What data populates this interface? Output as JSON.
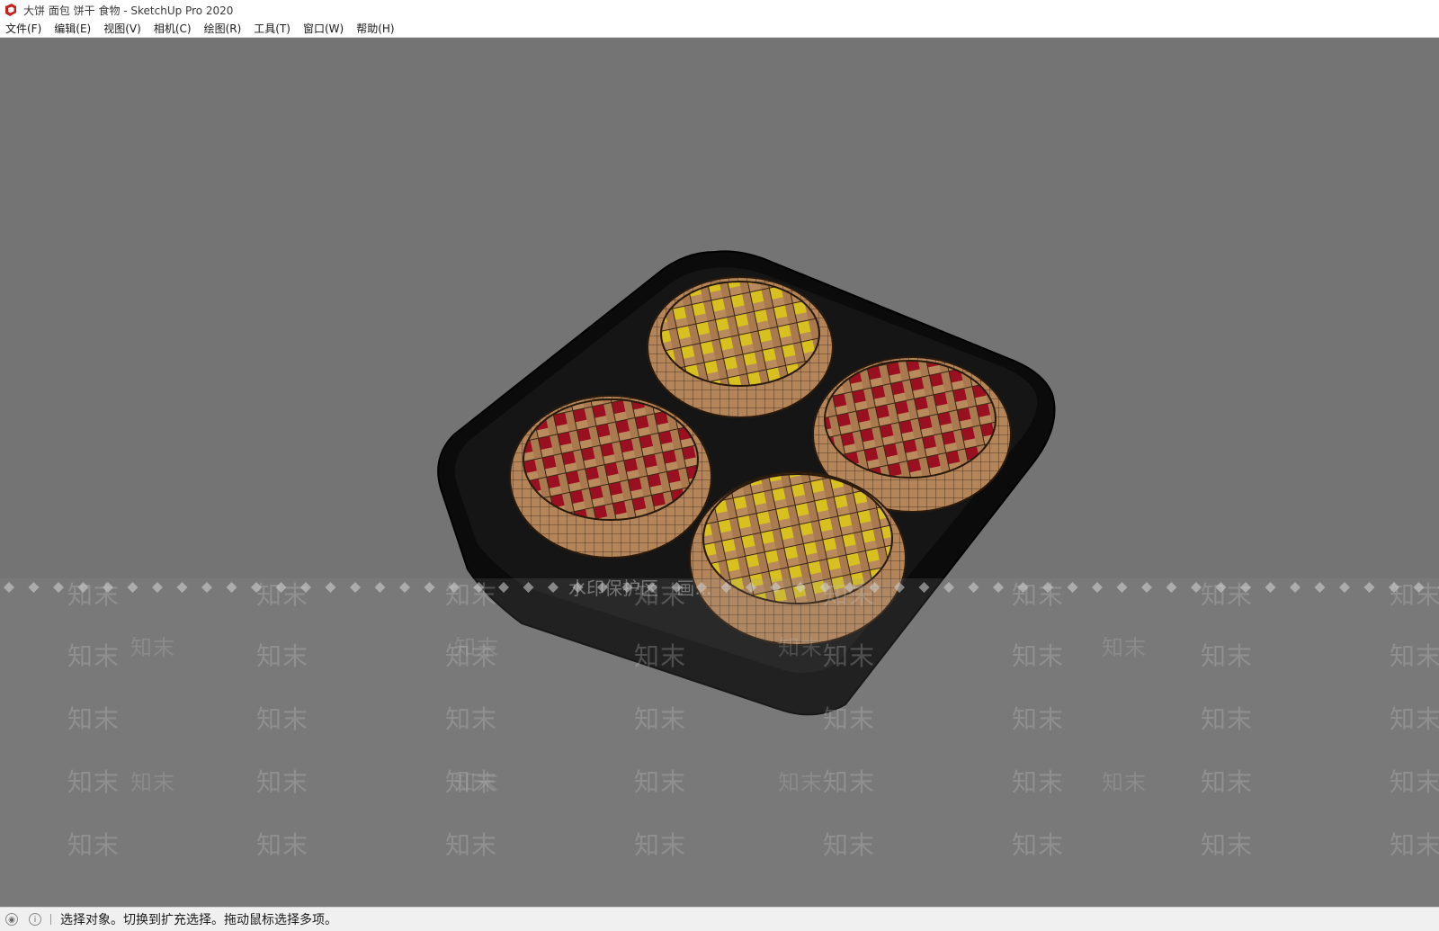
{
  "window": {
    "title": "大饼 面包 饼干 食物 - SketchUp Pro 2020"
  },
  "menu": [
    {
      "label": "文件(F)"
    },
    {
      "label": "编辑(E)"
    },
    {
      "label": "视图(V)"
    },
    {
      "label": "相机(C)"
    },
    {
      "label": "绘图(R)"
    },
    {
      "label": "工具(T)"
    },
    {
      "label": "窗口(W)"
    },
    {
      "label": "帮助(H)"
    }
  ],
  "viewport": {
    "background_color": "#747474",
    "model": "tray with four lattice pies",
    "pie_fillings": [
      "yellow",
      "red",
      "red",
      "yellow"
    ]
  },
  "watermark": {
    "banner": "水印保护区",
    "banner_tail": "画...",
    "tile": "知末"
  },
  "status": {
    "message": "选择对象。切换到扩充选择。拖动鼠标选择多项。"
  },
  "colors": {
    "accent_red": "#c4231b",
    "tray": "#0b0b0b",
    "crust": "#b9895c",
    "filling_red": "#9a1020",
    "filling_yellow": "#d8c020"
  }
}
